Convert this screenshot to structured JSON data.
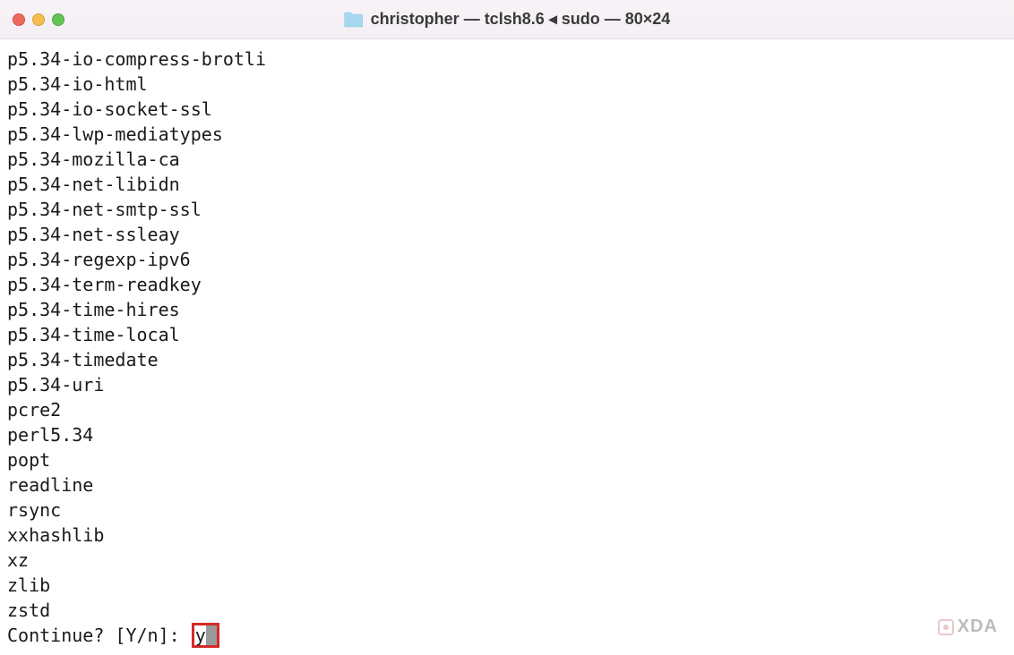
{
  "titlebar": {
    "title": "christopher — tclsh8.6 ◂ sudo — 80×24"
  },
  "terminal": {
    "lines": [
      "p5.34-io-compress-brotli",
      "p5.34-io-html",
      "p5.34-io-socket-ssl",
      "p5.34-lwp-mediatypes",
      "p5.34-mozilla-ca",
      "p5.34-net-libidn",
      "p5.34-net-smtp-ssl",
      "p5.34-net-ssleay",
      "p5.34-regexp-ipv6",
      "p5.34-term-readkey",
      "p5.34-time-hires",
      "p5.34-time-local",
      "p5.34-timedate",
      "p5.34-uri",
      "pcre2",
      "perl5.34",
      "popt",
      "readline",
      "rsync",
      "xxhashlib",
      "xz",
      "zlib",
      "zstd"
    ],
    "prompt": "Continue? [Y/n]: ",
    "input": "y"
  },
  "watermark": {
    "text": "XDA"
  }
}
